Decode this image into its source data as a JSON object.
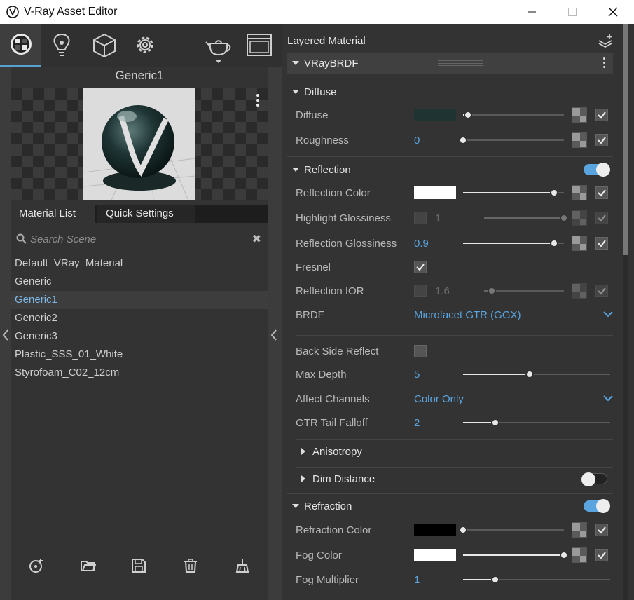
{
  "window": {
    "title": "V-Ray Asset Editor"
  },
  "left": {
    "material_name": "Generic1",
    "tabs": [
      "Material List",
      "Quick Settings"
    ],
    "search_placeholder": "Search Scene",
    "materials": [
      "Default_VRay_Material",
      "Generic",
      "Generic1",
      "Generic2",
      "Generic3",
      "Plastic_SSS_01_White",
      "Styrofoam_C02_12cm"
    ],
    "selected_index": 2,
    "top_icons": [
      "materials-icon",
      "lights-icon",
      "geometry-icon",
      "settings-icon",
      "render-teapot-icon",
      "frame-buffer-icon"
    ],
    "bottom_icons": [
      "add-material-icon",
      "open-file-icon",
      "save-icon",
      "delete-icon",
      "purge-icon"
    ]
  },
  "right": {
    "header": "Layered Material",
    "brdf_layer": "VRayBRDF",
    "diffuse": {
      "section": "Diffuse",
      "diffuse_label": "Diffuse",
      "diffuse_color": "#1f3333",
      "diffuse_amount": 0.05,
      "roughness_label": "Roughness",
      "roughness_value": "0",
      "roughness_amount": 0.0
    },
    "reflection": {
      "section": "Reflection",
      "enabled": true,
      "reflection_color_label": "Reflection Color",
      "reflection_color": "#ffffff",
      "reflection_color_amount": 0.9,
      "highlight_gloss_label": "Highlight Glossiness",
      "highlight_gloss_value": "1",
      "highlight_gloss_amount": 1.0,
      "reflection_gloss_label": "Reflection Glossiness",
      "reflection_gloss_value": "0.9",
      "reflection_gloss_amount": 0.9,
      "fresnel_label": "Fresnel",
      "fresnel_checked": true,
      "ior_label": "Reflection IOR",
      "ior_value": "1.6",
      "ior_amount": 0.1,
      "brdf_label": "BRDF",
      "brdf_value": "Microfacet GTR (GGX)",
      "back_side_label": "Back Side Reflect",
      "back_side_checked": false,
      "max_depth_label": "Max Depth",
      "max_depth_value": "5",
      "max_depth_amount": 0.45,
      "affect_channels_label": "Affect Channels",
      "affect_channels_value": "Color Only",
      "gtr_label": "GTR Tail Falloff",
      "gtr_value": "2",
      "gtr_amount": 0.22,
      "anisotropy_section": "Anisotropy",
      "dim_distance_section": "Dim Distance",
      "dim_distance_enabled": false
    },
    "refraction": {
      "section": "Refraction",
      "enabled": true,
      "refraction_color_label": "Refraction Color",
      "refraction_color": "#000000",
      "refraction_color_amount": 0.0,
      "fog_color_label": "Fog Color",
      "fog_color": "#ffffff",
      "fog_color_amount": 1.0,
      "fog_multiplier_label": "Fog Multiplier",
      "fog_multiplier_value": "1",
      "fog_multiplier_amount": 0.22
    }
  },
  "colors": {
    "accent": "#5aa5e0",
    "selected_text": "#7fb8e6"
  }
}
